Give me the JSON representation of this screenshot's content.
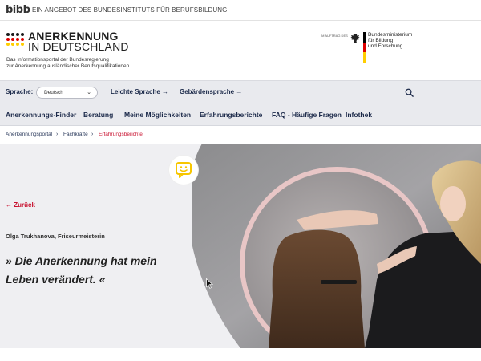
{
  "topbar": {
    "logo_text": "bibb",
    "tagline": "EIN ANGEBOT DES BUNDESINSTITUTS FÜR BERUFSBILDUNG"
  },
  "header": {
    "brand_line1": "ANERKENNUNG",
    "brand_line2": "IN DEUTSCHLAND",
    "description_line1": "Das Informationsportal der Bundesregierung",
    "description_line2": "zur Anerkennung ausländischer Berufsqualifikationen",
    "ministry_note": "IM AUFTRAG DES",
    "ministry_line1": "Bundesministerium",
    "ministry_line2": "für Bildung",
    "ministry_line3": "und Forschung",
    "flag_colors": [
      "#000000",
      "#dd0000",
      "#ffce00"
    ]
  },
  "langbar": {
    "label": "Sprache:",
    "selected_language": "Deutsch",
    "leichte_sprache": "Leichte Sprache →",
    "gebaerdensprache": "Gebärdensprache →",
    "search_icon": "search-icon"
  },
  "nav": {
    "items": [
      {
        "label": "Anerkennungs-Finder"
      },
      {
        "label": "Beratung"
      },
      {
        "label": "Meine Möglichkeiten"
      },
      {
        "label": "Erfahrungsberichte",
        "active": true
      },
      {
        "label": "FAQ - Häufige Fragen"
      },
      {
        "label": "Infothek"
      }
    ]
  },
  "breadcrumb": {
    "items": [
      "Anerkennungsportal",
      "Fachkräfte",
      "Erfahrungsberichte"
    ]
  },
  "hero": {
    "back_label": "← Zurück",
    "person": "Olga Trukhanova, Friseurmeisterin",
    "quote_line1": "» Die Anerkennung hat mein",
    "quote_line2": "Leben verändert. «",
    "badge_icon": "speech-bubble-smile-icon"
  },
  "colors": {
    "accent_red": "#c8102e",
    "nav_text": "#1c2a4a",
    "nav_bg": "#e9eaee",
    "badge_yellow": "#f7c600"
  }
}
